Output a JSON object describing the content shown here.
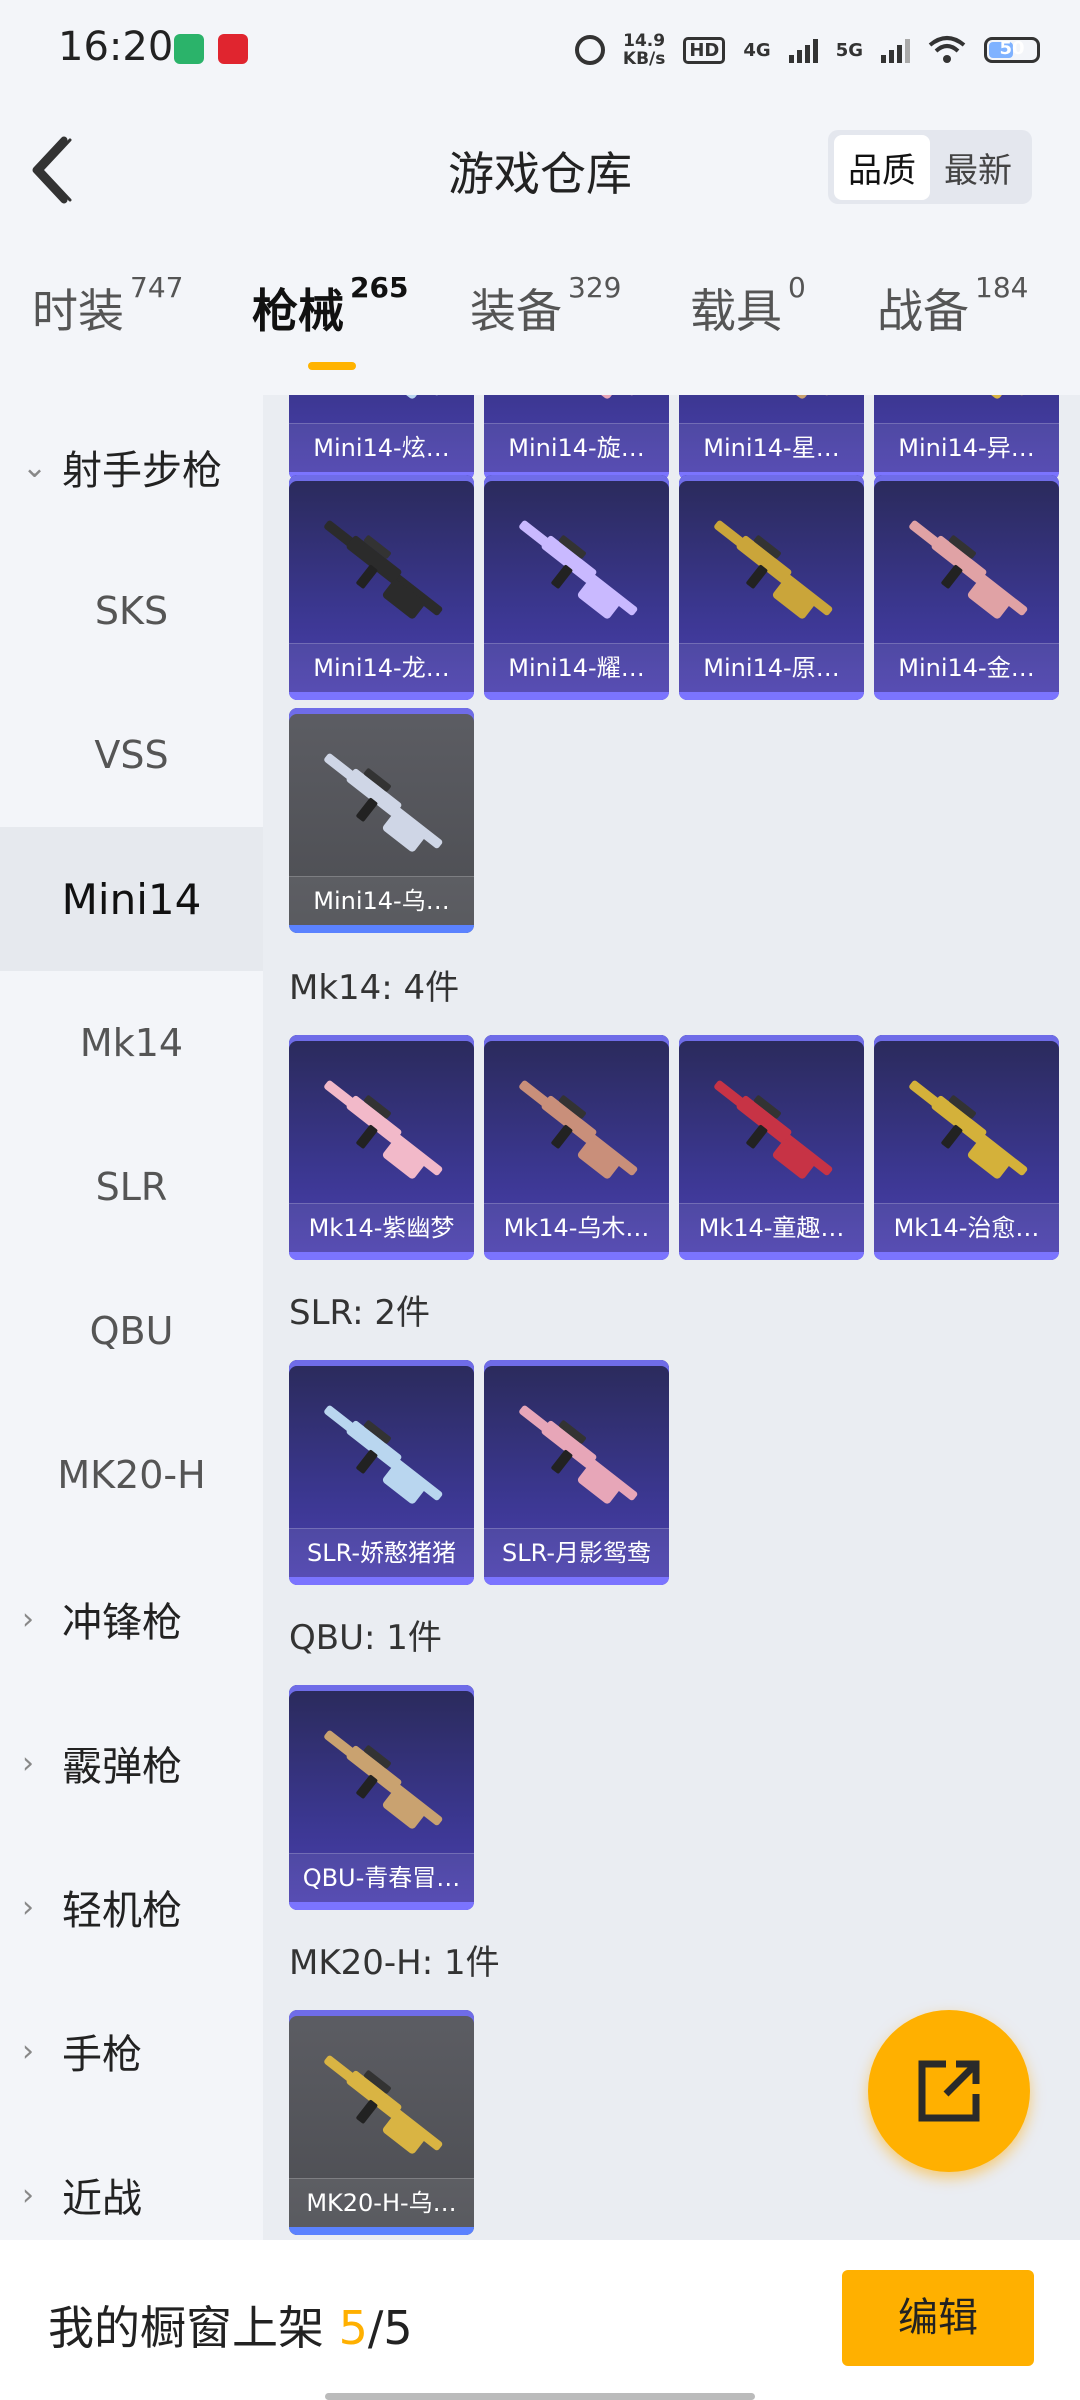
{
  "status": {
    "time": "16:20",
    "speed_value": "14.9",
    "speed_unit": "KB/s",
    "hd": "HD",
    "net1": "4G",
    "net2": "5G",
    "battery": "50"
  },
  "header": {
    "title": "游戏仓库",
    "sort_quality": "品质",
    "sort_new": "最新"
  },
  "tabs": [
    {
      "label": "时装",
      "count": "747"
    },
    {
      "label": "枪械",
      "count": "265"
    },
    {
      "label": "装备",
      "count": "329"
    },
    {
      "label": "载具",
      "count": "0"
    },
    {
      "label": "战备",
      "count": "184"
    }
  ],
  "sidebar": {
    "group_open": "射手步枪",
    "items": [
      "SKS",
      "VSS",
      "Mini14",
      "Mk14",
      "SLR",
      "QBU",
      "MK20-H"
    ],
    "groups": [
      "冲锋枪",
      "霰弹枪",
      "轻机枪",
      "手枪",
      "近战"
    ]
  },
  "content": {
    "top_row": [
      "Mini14-炫…",
      "Mini14-旋…",
      "Mini14-星…",
      "Mini14-异…"
    ],
    "row2": [
      "Mini14-龙…",
      "Mini14-耀…",
      "Mini14-原…",
      "Mini14-金…"
    ],
    "row3": [
      "Mini14-乌…"
    ],
    "mk14_title": "Mk14: 4件",
    "mk14": [
      "Mk14-紫幽梦",
      "Mk14-乌木…",
      "Mk14-童趣…",
      "Mk14-治愈…"
    ],
    "slr_title": "SLR: 2件",
    "slr": [
      "SLR-娇憨猪猪",
      "SLR-月影鸳鸯"
    ],
    "qbu_title": "QBU: 1件",
    "qbu": [
      "QBU-青春冒…"
    ],
    "mk20_title": "MK20-H: 1件",
    "mk20": [
      "MK20-H-乌…"
    ]
  },
  "footer": {
    "label": "我的橱窗上架",
    "current": "5",
    "sep": "/",
    "total": "5",
    "edit": "编辑"
  },
  "colors": {
    "accent": "#ffb000",
    "card_purple": "#3b3790",
    "card_grey": "#55565b"
  }
}
